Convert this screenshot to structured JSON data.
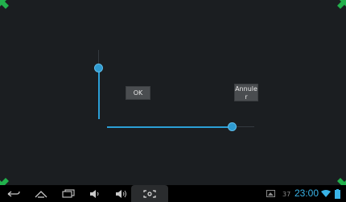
{
  "dialog": {
    "ok_label": "OK",
    "cancel_label": "Annule\nr"
  },
  "status_bar": {
    "time": "23:00",
    "accent_color": "#39b3e7"
  },
  "icons": {
    "back": "back-icon",
    "home": "home-icon",
    "recent": "recent-apps-icon",
    "vol_down": "volume-down-icon",
    "vol_up": "volume-up-icon",
    "screenshot": "screenshot-icon",
    "gallery": "gallery-icon",
    "notification": "notification-icon",
    "wifi": "wifi-icon",
    "battery": "battery-icon"
  }
}
